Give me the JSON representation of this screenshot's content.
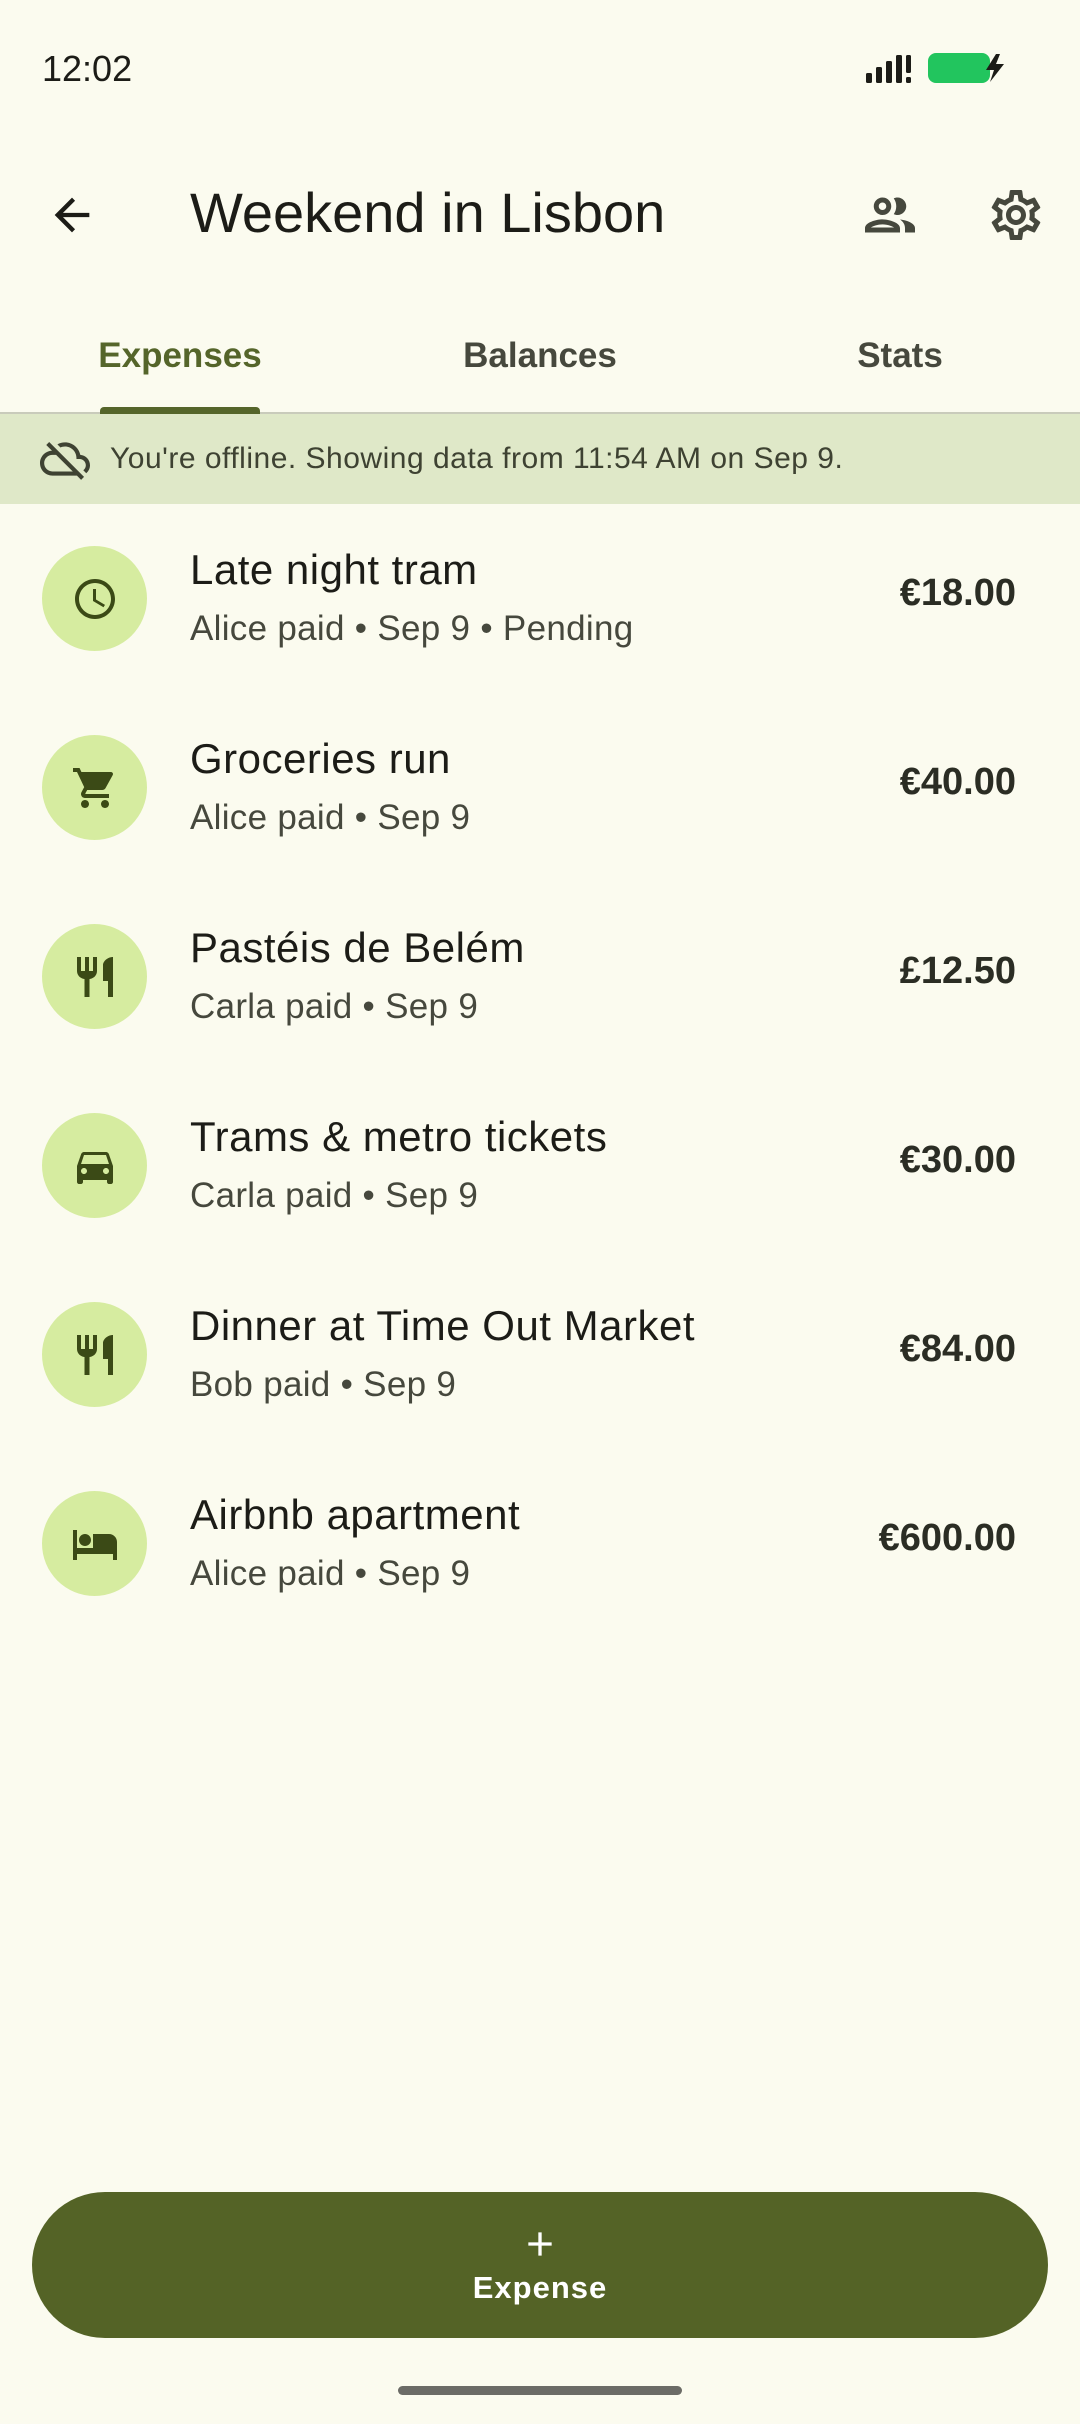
{
  "status_bar": {
    "time": "12:02"
  },
  "app_bar": {
    "title": "Weekend in Lisbon",
    "icons": [
      "arrow-back-icon",
      "people-icon",
      "settings-icon"
    ]
  },
  "tabs": [
    {
      "label": "Expenses",
      "active": true
    },
    {
      "label": "Balances",
      "active": false
    },
    {
      "label": "Stats",
      "active": false
    }
  ],
  "offline_banner": {
    "icon": "cloud-off-icon",
    "text": "You're offline. Showing data from 11:54 AM on Sep 9."
  },
  "expenses": [
    {
      "icon": "clock-icon",
      "title": "Late night tram",
      "meta": "Alice paid • Sep 9 • Pending",
      "amount": "€18.00"
    },
    {
      "icon": "cart-icon",
      "title": "Groceries run",
      "meta": "Alice paid • Sep 9",
      "amount": "€40.00"
    },
    {
      "icon": "restaurant-icon",
      "title": "Pastéis de Belém",
      "meta": "Carla paid • Sep 9",
      "amount": "£12.50"
    },
    {
      "icon": "car-icon",
      "title": "Trams & metro tickets",
      "meta": "Carla paid • Sep 9",
      "amount": "€30.00"
    },
    {
      "icon": "restaurant-icon",
      "title": "Dinner at Time Out Market",
      "meta": "Bob paid • Sep 9",
      "amount": "€84.00"
    },
    {
      "icon": "bed-icon",
      "title": "Airbnb apartment",
      "meta": "Alice paid • Sep 9",
      "amount": "€600.00"
    }
  ],
  "fab": {
    "label": "Expense",
    "icon": "plus-icon"
  },
  "colors": {
    "background": "#fbfbef",
    "primary": "#55652a",
    "banner": "#dfe8c8",
    "avatar": "#d6eca0",
    "battery": "#22c55e"
  }
}
